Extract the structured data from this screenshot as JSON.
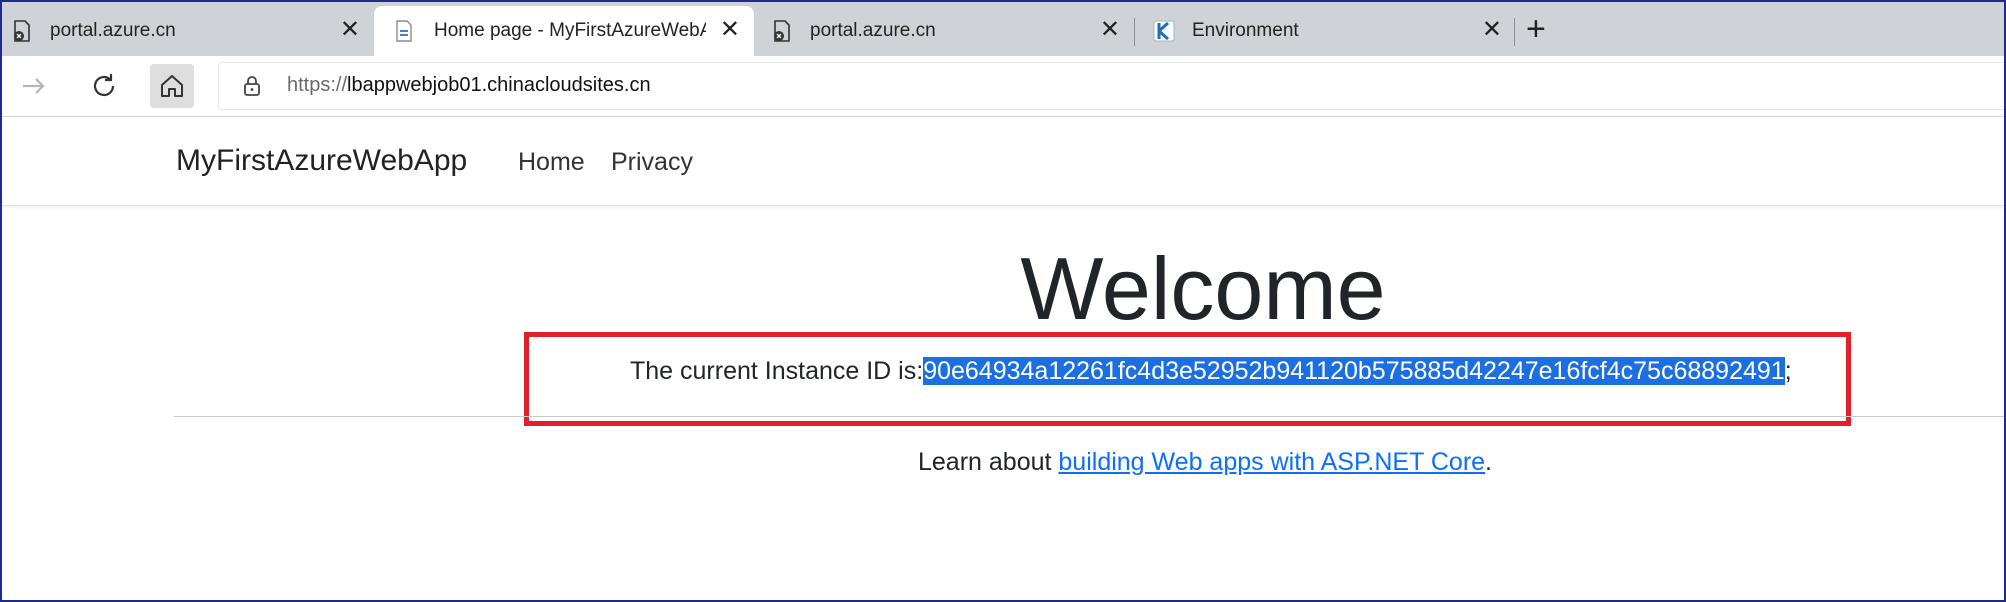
{
  "browser": {
    "tabs": [
      {
        "title": "portal.azure.cn",
        "close": "✕"
      },
      {
        "title": "Home page - MyFirstAzureWebA",
        "close": "✕"
      },
      {
        "title": "portal.azure.cn",
        "close": "✕"
      },
      {
        "title": "Environment",
        "close": "✕"
      }
    ],
    "new_tab": "+",
    "url_scheme": "https://",
    "url_host": "lbappwebjob01.chinacloudsites.cn"
  },
  "site": {
    "brand": "MyFirstAzureWebApp",
    "nav": [
      "Home",
      "Privacy"
    ]
  },
  "main": {
    "heading": "Welcome",
    "instance_prefix": "The current Instance ID is:",
    "instance_id": "90e64934a12261fc4d3e52952b941120b575885d42247e16fcf4c75c68892491",
    "instance_suffix": ";",
    "learn_prefix": "Learn about ",
    "learn_link": "building Web apps with ASP.NET Core",
    "learn_suffix": "."
  },
  "colors": {
    "highlight_border": "#e0202a",
    "selection": "#1c6fe0",
    "link": "#0d6efd",
    "frame": "#1e2a8c"
  }
}
